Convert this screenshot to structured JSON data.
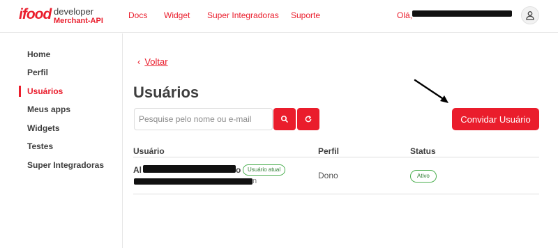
{
  "header": {
    "logo": "ifood",
    "brand_line1": "developer",
    "brand_line2": "Merchant-API",
    "nav": [
      "Docs",
      "Widget",
      "Super Integradoras",
      "Suporte"
    ],
    "greeting": "Olá,",
    "user_icon": "user-icon"
  },
  "sidebar": {
    "items": [
      {
        "label": "Home"
      },
      {
        "label": "Perfil"
      },
      {
        "label": "Usuários",
        "active": true
      },
      {
        "label": "Meus apps"
      },
      {
        "label": "Widgets"
      },
      {
        "label": "Testes"
      },
      {
        "label": "Super Integradoras"
      }
    ]
  },
  "main": {
    "back_label": "Voltar",
    "title": "Usuários",
    "search_placeholder": "Pesquise pelo nome ou e-mail",
    "invite_label": "Convidar Usuário",
    "table": {
      "headers": [
        "Usuário",
        "Perfil",
        "Status"
      ],
      "rows": [
        {
          "name_visible": "Al",
          "name_end": "o",
          "email_end": "n",
          "badge": "Usuário atual",
          "perfil": "Dono",
          "status": "Ativo"
        }
      ]
    }
  },
  "colors": {
    "brand": "#ea1d2c",
    "text": "#3e3e3e",
    "status_green": "#4caf50"
  }
}
